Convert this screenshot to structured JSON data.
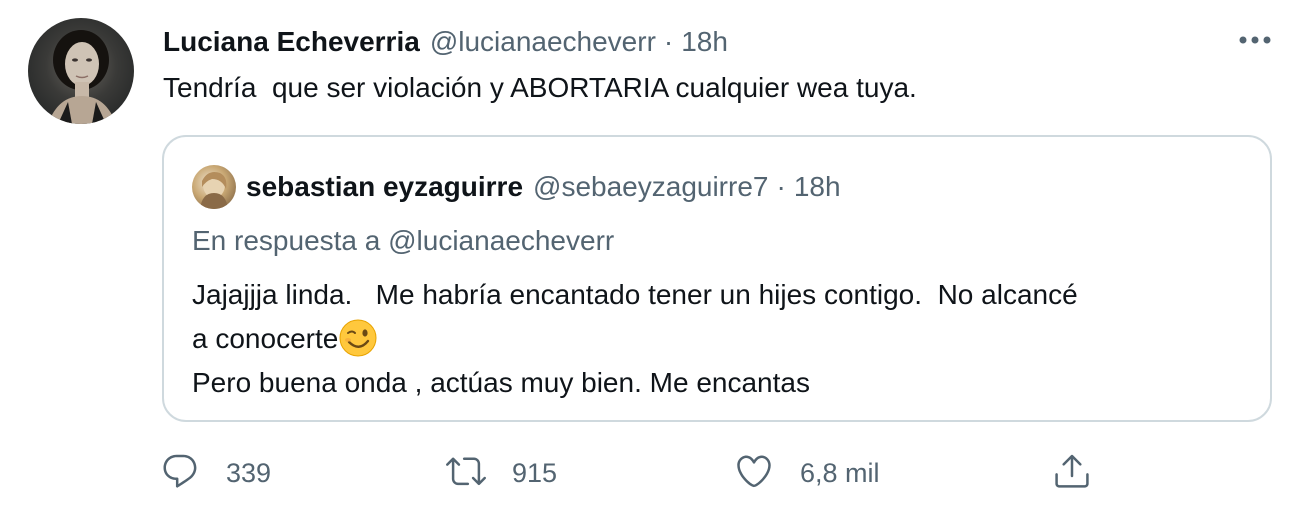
{
  "tweet": {
    "author_name": "Luciana Echeverria",
    "author_handle": "@lucianaecheverr",
    "separator": "·",
    "time": "18h",
    "text": "Tendría  que ser violación y ABORTARIA cualquier wea tuya."
  },
  "quote": {
    "author_name": "sebastian eyzaguirre",
    "author_handle": "@sebaeyzaguirre7",
    "separator": "·",
    "time": "18h",
    "reply_to": "En respuesta a @lucianaecheverr",
    "lines": [
      "Jajajjja linda.   Me habría encantado tener un hijes contigo.  No alcancé",
      "a conocerte",
      "Pero buena onda , actúas muy bien. Me encantas"
    ],
    "emoji": "winking-face"
  },
  "actions": {
    "reply_count": "339",
    "retweet_count": "915",
    "like_count": "6,8 mil"
  },
  "colors": {
    "text_primary": "#0f1419",
    "text_secondary": "#536471",
    "border": "#cfd9de",
    "emoji": "#ffc83d"
  },
  "icons": [
    "more-icon",
    "reply-icon",
    "retweet-icon",
    "like-icon",
    "share-icon"
  ]
}
